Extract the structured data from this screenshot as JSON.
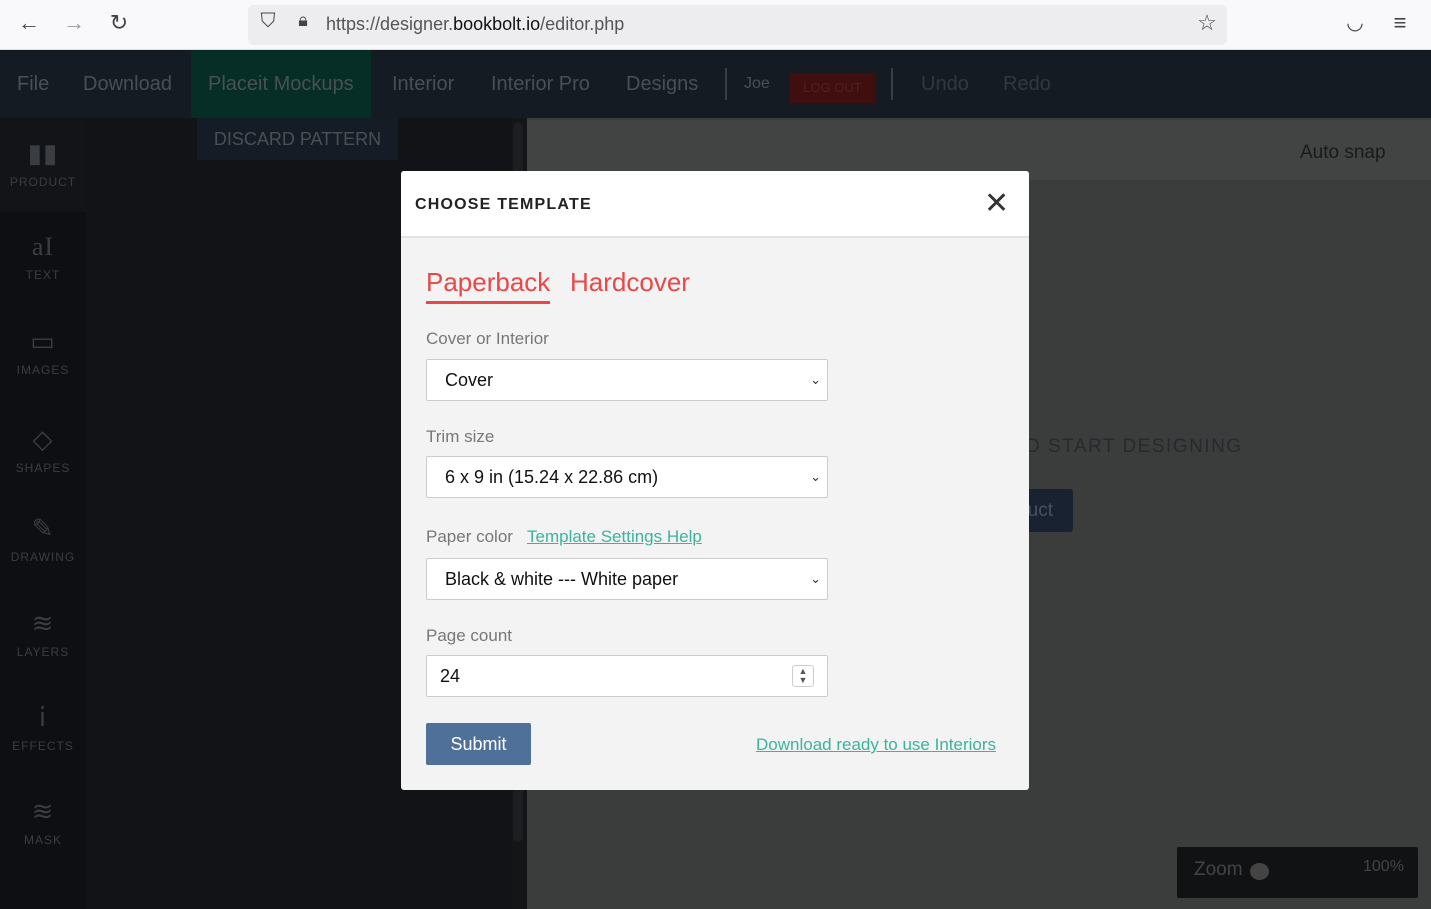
{
  "browser": {
    "url_prefix": "https://designer.",
    "url_domain": "bookbolt.io",
    "url_path": "/editor.php",
    "icons": [
      "back-icon",
      "forward-icon",
      "reload-icon",
      "shield-icon",
      "lock-icon",
      "star-icon",
      "pocket-icon",
      "menu-icon"
    ]
  },
  "nav": {
    "items": [
      "File",
      "Download",
      "Placeit Mockups",
      "Interior",
      "Interior Pro",
      "Designs"
    ],
    "user": "Joe",
    "logout": "LOG OUT",
    "undo": "Undo",
    "redo": "Redo"
  },
  "sidebar": {
    "items": [
      {
        "label": "PRODUCT",
        "icon": "book-icon"
      },
      {
        "label": "TEXT",
        "icon": "text-icon"
      },
      {
        "label": "IMAGES",
        "icon": "image-icon"
      },
      {
        "label": "SHAPES",
        "icon": "diamond-icon"
      },
      {
        "label": "DRAWING",
        "icon": "pencil-icon"
      },
      {
        "label": "LAYERS",
        "icon": "layers-icon"
      },
      {
        "label": "EFFECTS",
        "icon": "flask-icon"
      },
      {
        "label": "MASK",
        "icon": "mask-icon"
      }
    ]
  },
  "panel": {
    "discard": "DISCARD PATTERN"
  },
  "canvas": {
    "auto_snap": "Auto snap",
    "start_text": "D START DESIGNING",
    "product_btn": "uct",
    "zoom_label": "Zoom",
    "zoom_value": "100%"
  },
  "modal": {
    "title": "CHOOSE TEMPLATE",
    "tabs": [
      "Paperback",
      "Hardcover"
    ],
    "active_tab": "Paperback",
    "cover_label": "Cover or Interior",
    "cover_value": "Cover",
    "trim_label": "Trim size",
    "trim_value": "6 x 9 in (15.24 x 22.86 cm)",
    "paper_label": "Paper color",
    "help_link": "Template Settings Help",
    "paper_value": "Black & white --- White paper",
    "count_label": "Page count",
    "count_value": "24",
    "submit": "Submit",
    "download_link": "Download ready to use Interiors"
  },
  "colors": {
    "accent_red": "#e94848",
    "link_teal": "#3bb39e",
    "submit_blue": "#4f7098"
  }
}
